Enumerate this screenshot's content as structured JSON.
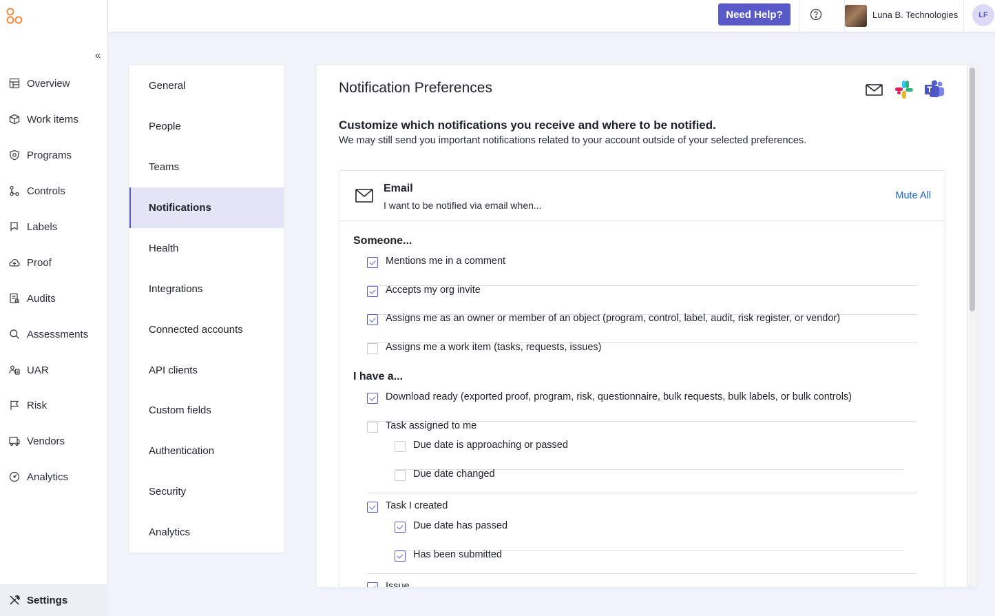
{
  "nav": {
    "items": [
      {
        "label": "Overview",
        "icon": "layout-icon"
      },
      {
        "label": "Work items",
        "icon": "box-icon"
      },
      {
        "label": "Programs",
        "icon": "shield-icon"
      },
      {
        "label": "Controls",
        "icon": "controls-icon"
      },
      {
        "label": "Labels",
        "icon": "flag-icon"
      },
      {
        "label": "Proof",
        "icon": "cloud-icon"
      },
      {
        "label": "Audits",
        "icon": "audit-icon"
      },
      {
        "label": "Assessments",
        "icon": "search-icon"
      },
      {
        "label": "UAR",
        "icon": "users-icon"
      },
      {
        "label": "Risk",
        "icon": "risk-flag-icon"
      },
      {
        "label": "Vendors",
        "icon": "truck-icon"
      },
      {
        "label": "Analytics",
        "icon": "gauge-icon"
      }
    ],
    "settings_label": "Settings",
    "collapse_glyph": "«"
  },
  "header": {
    "help_label": "Need Help?",
    "org_name": "Luna B. Technologies",
    "user_initials": "LF"
  },
  "settings_menu": {
    "items": [
      "General",
      "People",
      "Teams",
      "Notifications",
      "Health",
      "Integrations",
      "Connected accounts",
      "API clients",
      "Custom fields",
      "Authentication",
      "Security",
      "Analytics"
    ],
    "active": "Notifications"
  },
  "panel": {
    "title": "Notification Preferences",
    "heading": "Customize which notifications you receive and where to be notified.",
    "subheading": "We may still send you important notifications related to your account outside of your selected preferences.",
    "channels": [
      "email-icon",
      "slack-icon",
      "teams-icon"
    ]
  },
  "email_card": {
    "title": "Email",
    "description": "I want to be notified via email when...",
    "mute_all": "Mute All",
    "groups": [
      {
        "label": "Someone...",
        "options": [
          {
            "label": "Mentions me in a comment",
            "checked": true
          },
          {
            "label": "Accepts my org invite",
            "checked": true
          },
          {
            "label": "Assigns me as an owner or member of an object (program, control, label, audit, risk register, or vendor)",
            "checked": true
          },
          {
            "label": "Assigns me a work item (tasks, requests, issues)",
            "checked": false
          }
        ]
      },
      {
        "label": "I have a...",
        "options": [
          {
            "label": "Download ready (exported proof, program, risk, questionnaire, bulk requests, bulk labels, or bulk controls)",
            "checked": true
          },
          {
            "label": "Task assigned to me",
            "checked": false,
            "children": [
              {
                "label": "Due date is approaching or passed",
                "checked": false
              },
              {
                "label": "Due date changed",
                "checked": false
              }
            ]
          },
          {
            "label": "Task I created",
            "checked": true,
            "children": [
              {
                "label": "Due date has passed",
                "checked": true
              },
              {
                "label": "Has been submitted",
                "checked": true
              }
            ]
          },
          {
            "label": "Issue",
            "checked": true
          }
        ]
      }
    ]
  }
}
